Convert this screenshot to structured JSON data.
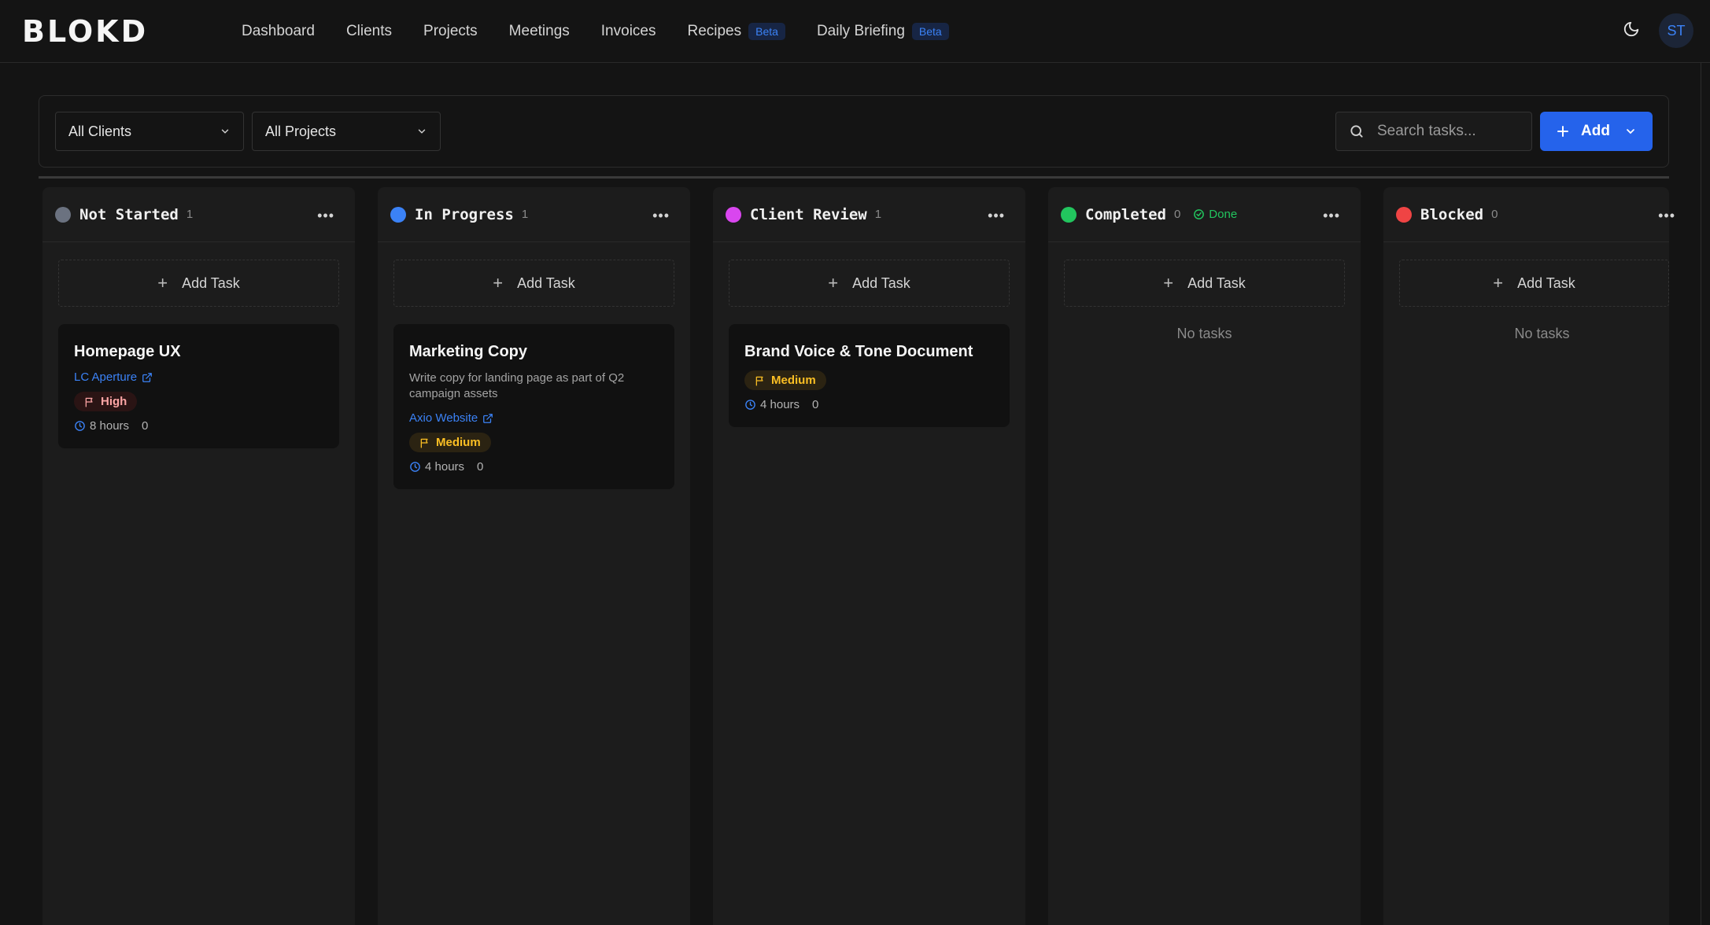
{
  "app": {
    "logo": "BLOKD"
  },
  "nav": [
    {
      "label": "Dashboard"
    },
    {
      "label": "Clients"
    },
    {
      "label": "Projects"
    },
    {
      "label": "Meetings"
    },
    {
      "label": "Invoices"
    },
    {
      "label": "Recipes",
      "badge": "Beta"
    },
    {
      "label": "Daily Briefing",
      "badge": "Beta"
    }
  ],
  "user": {
    "initials": "ST"
  },
  "filters": {
    "client": "All Clients",
    "project": "All Projects",
    "search_placeholder": "Search tasks...",
    "add_label": "Add"
  },
  "columns": [
    {
      "title": "Not Started",
      "count": "1",
      "color": "#6b7280",
      "add_label": "Add Task",
      "cards": [
        {
          "title": "Homepage UX",
          "client": "LC Aperture",
          "priority": "High",
          "hours": "8 hours",
          "comments": "0"
        }
      ]
    },
    {
      "title": "In Progress",
      "count": "1",
      "color": "#3b82f6",
      "add_label": "Add Task",
      "cards": [
        {
          "title": "Marketing Copy",
          "description": "Write copy for landing page as part of Q2 campaign assets",
          "client": "Axio Website",
          "priority": "Medium",
          "hours": "4 hours",
          "comments": "0"
        }
      ]
    },
    {
      "title": "Client Review",
      "count": "1",
      "color": "#d946ef",
      "add_label": "Add Task",
      "cards": [
        {
          "title": "Brand Voice & Tone Document",
          "priority": "Medium",
          "hours": "4 hours",
          "comments": "0"
        }
      ]
    },
    {
      "title": "Completed",
      "count": "0",
      "color": "#22c55e",
      "badge": "Done",
      "add_label": "Add Task",
      "empty": "No tasks"
    },
    {
      "title": "Blocked",
      "count": "0",
      "color": "#ef4444",
      "add_label": "Add Task",
      "empty": "No tasks"
    }
  ]
}
